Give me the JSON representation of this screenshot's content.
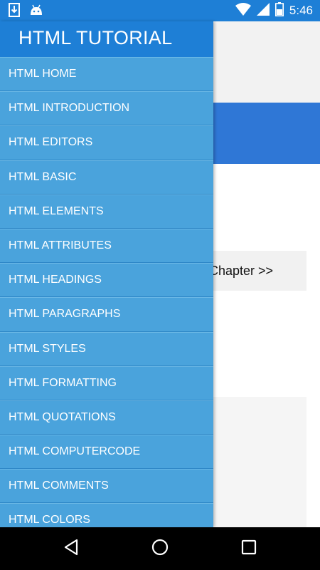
{
  "status_bar": {
    "time": "5:46",
    "icons": [
      "download-icon",
      "android-icon",
      "wifi-icon",
      "signal-icon",
      "battery-icon"
    ]
  },
  "content": {
    "next_button_label": "t Chapter >>"
  },
  "drawer": {
    "title": "HTML TUTORIAL",
    "items": [
      {
        "label": "HTML HOME"
      },
      {
        "label": "HTML INTRODUCTION"
      },
      {
        "label": "HTML EDITORS"
      },
      {
        "label": "HTML BASIC"
      },
      {
        "label": "HTML ELEMENTS"
      },
      {
        "label": "HTML ATTRIBUTES"
      },
      {
        "label": "HTML HEADINGS"
      },
      {
        "label": "HTML PARAGRAPHS"
      },
      {
        "label": "HTML STYLES"
      },
      {
        "label": "HTML FORMATTING"
      },
      {
        "label": "HTML QUOTATIONS"
      },
      {
        "label": "HTML COMPUTERCODE"
      },
      {
        "label": "HTML COMMENTS"
      },
      {
        "label": "HTML COLORS"
      }
    ]
  },
  "nav_bar": {
    "buttons": [
      "back-icon",
      "home-icon",
      "recents-icon"
    ]
  },
  "colors": {
    "status_bar": "#1e7fd6",
    "drawer_item": "#4aa3dc",
    "content_blue": "#2f77d6"
  }
}
